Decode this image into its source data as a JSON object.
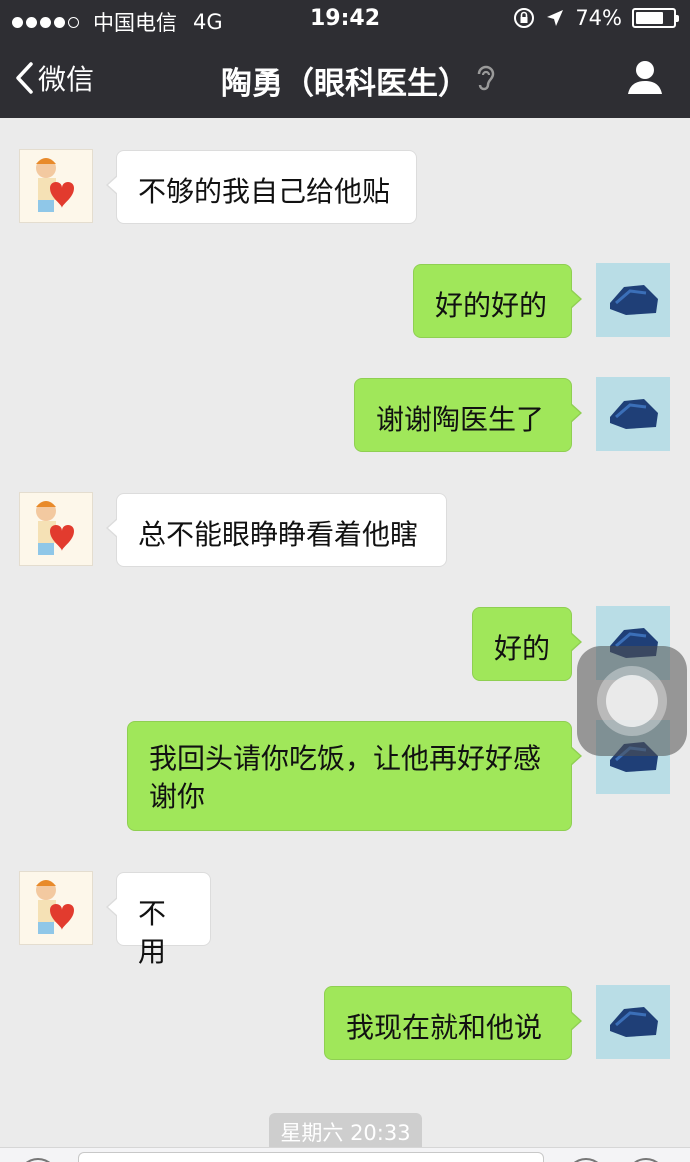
{
  "status_bar": {
    "carrier": "中国电信",
    "network": "4G",
    "time": "19:42",
    "battery_percent": "74%",
    "battery_level": 0.74
  },
  "nav": {
    "back_label": "微信",
    "title": "陶勇（眼科医生）"
  },
  "colors": {
    "nav_background": "#2e2e33",
    "chat_background": "#ebebeb",
    "outgoing_bubble": "#a0e75a",
    "incoming_bubble": "#ffffff"
  },
  "messages": [
    {
      "side": "friend",
      "text": "不够的我自己给他贴"
    },
    {
      "side": "me",
      "text": "好的好的"
    },
    {
      "side": "me",
      "text": "谢谢陶医生了"
    },
    {
      "side": "friend",
      "text": "总不能眼睁睁看着他瞎"
    },
    {
      "side": "me",
      "text": "好的"
    },
    {
      "side": "me",
      "text": "我回头请你吃饭，让他再好好感谢你"
    },
    {
      "side": "friend",
      "text": "不用"
    },
    {
      "side": "me",
      "text": "我现在就和他说"
    }
  ],
  "timestamp": "星期六 20:33",
  "icons": {
    "back": "chevron-left-icon",
    "ear": "ear-icon",
    "profile": "profile-icon",
    "location": "location-arrow-icon",
    "lock": "rotation-lock-icon"
  }
}
